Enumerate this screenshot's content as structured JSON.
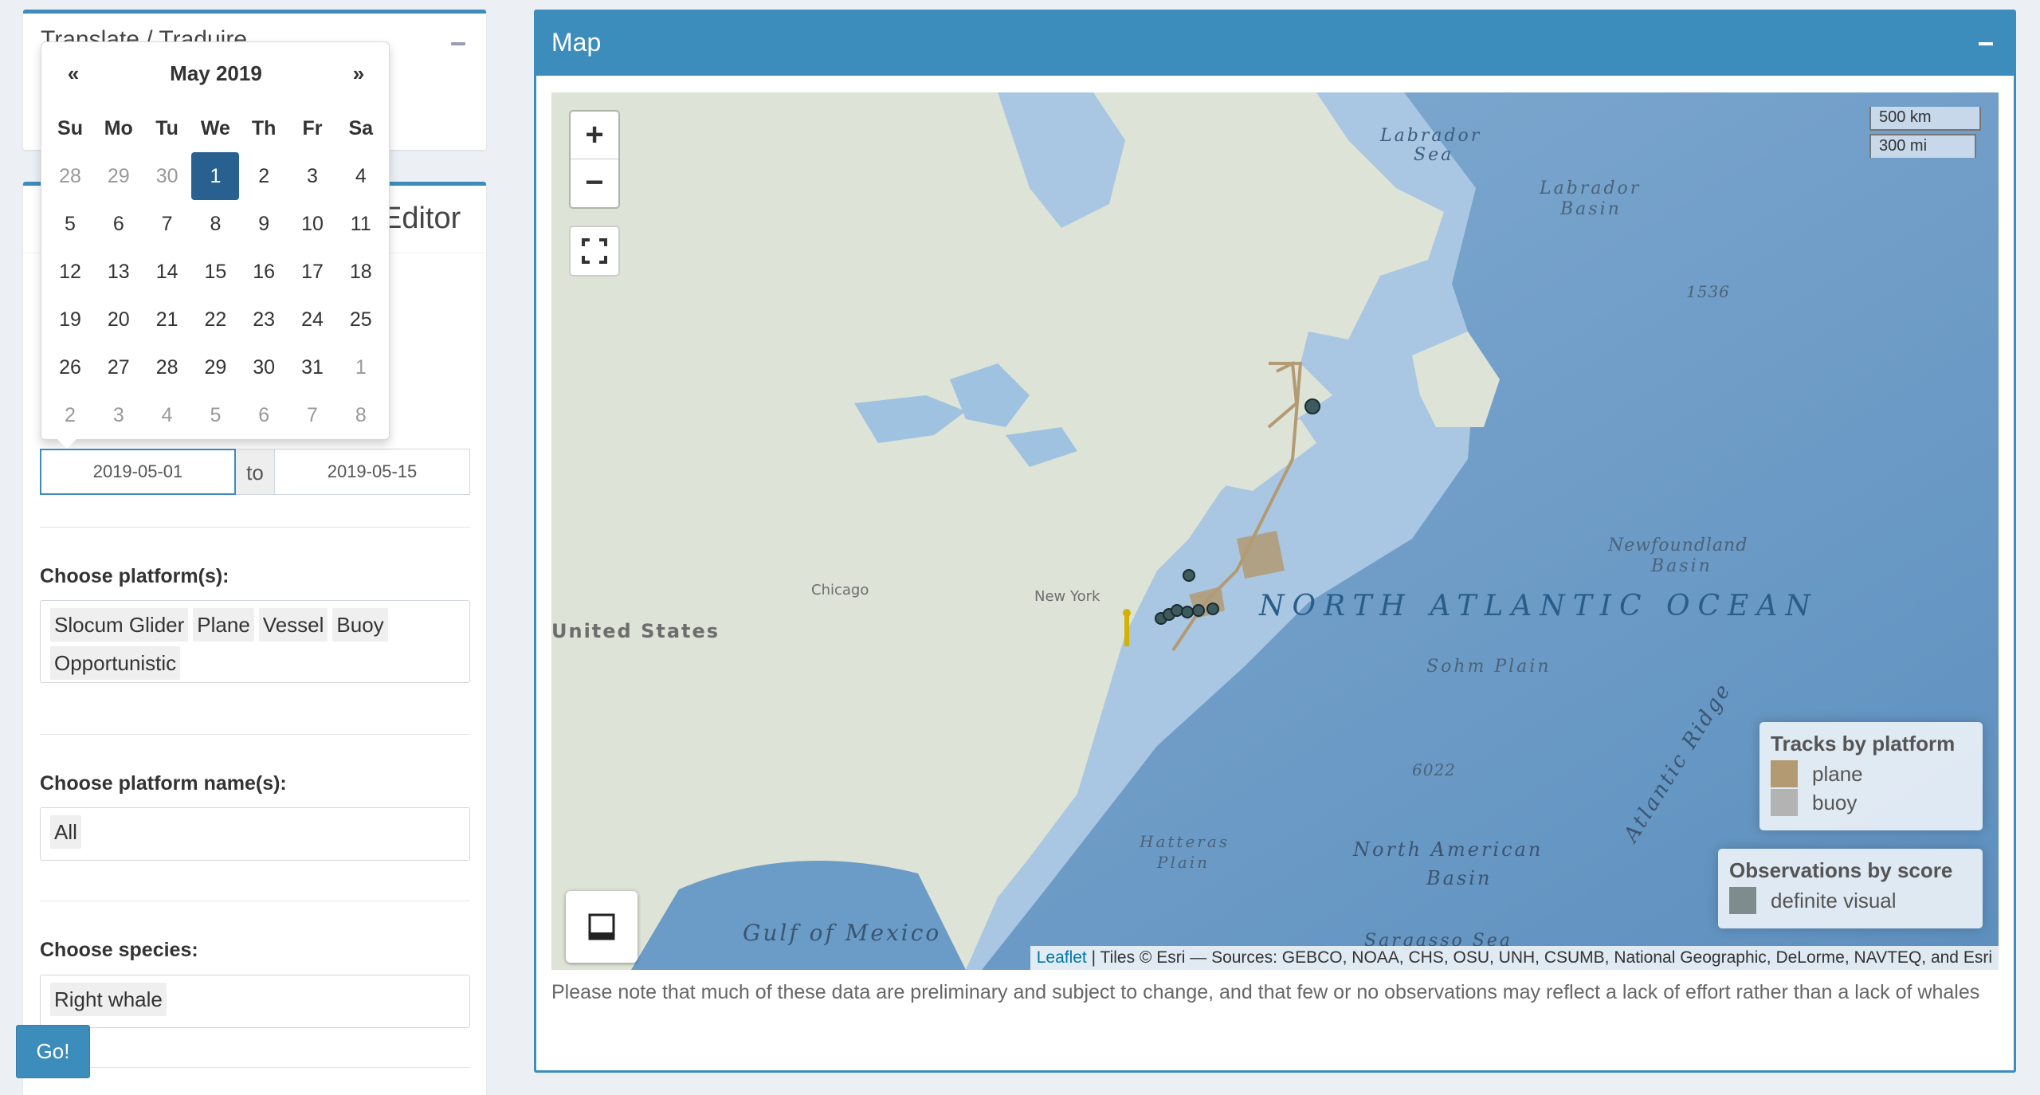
{
  "translate_box": {
    "title": "Translate / Traduire"
  },
  "filters_box": {
    "title_fragment": "Editor"
  },
  "datepicker": {
    "prev": "«",
    "next": "»",
    "month": "May 2019",
    "weekdays": [
      "Su",
      "Mo",
      "Tu",
      "We",
      "Th",
      "Fr",
      "Sa"
    ],
    "weeks": [
      [
        "28",
        "29",
        "30",
        "1",
        "2",
        "3",
        "4"
      ],
      [
        "5",
        "6",
        "7",
        "8",
        "9",
        "10",
        "11"
      ],
      [
        "12",
        "13",
        "14",
        "15",
        "16",
        "17",
        "18"
      ],
      [
        "19",
        "20",
        "21",
        "22",
        "23",
        "24",
        "25"
      ],
      [
        "26",
        "27",
        "28",
        "29",
        "30",
        "31",
        "1"
      ],
      [
        "2",
        "3",
        "4",
        "5",
        "6",
        "7",
        "8"
      ]
    ],
    "selected": "1"
  },
  "date_range": {
    "start": "2019-05-01",
    "separator": "to",
    "end": "2019-05-15"
  },
  "platforms": {
    "label": "Choose platform(s):",
    "chips": [
      "Slocum Glider",
      "Plane",
      "Vessel",
      "Buoy",
      "Opportunistic"
    ]
  },
  "platform_names": {
    "label": "Choose platform name(s):",
    "chips": [
      "All"
    ]
  },
  "species": {
    "label": "Choose species:",
    "chips": [
      "Right whale"
    ]
  },
  "go_button": "Go!",
  "map": {
    "title": "Map",
    "zoom_in": "+",
    "zoom_out": "−",
    "scale_km": "500 km",
    "scale_mi": "300 mi",
    "labels": {
      "labrador_sea_1": "Labrador",
      "labrador_sea_2": "Sea",
      "labrador_basin_1": "Labrador",
      "labrador_basin_2": "Basin",
      "depth_1536": "1536",
      "newfoundland_basin_1": "Newfoundland",
      "newfoundland_basin_2": "Basin",
      "north_atlantic": "NORTH ATLANTIC OCEAN",
      "sohm_plain": "Sohm Plain",
      "depth_6022": "6022",
      "hatteras_1": "Hatteras",
      "hatteras_2": "Plain",
      "na_basin_1": "North American",
      "na_basin_2": "Basin",
      "gulf_mexico": "Gulf of Mexico",
      "united_states": "United States",
      "chicago": "Chicago",
      "new_york": "New York",
      "atlantic_ridge": "Atlantic Ridge",
      "sargasso": "Sargasso Sea"
    },
    "legend_tracks": {
      "title": "Tracks by platform",
      "items": [
        {
          "label": "plane",
          "color": "#b39a73"
        },
        {
          "label": "buoy",
          "color": "#b3b3b3"
        }
      ]
    },
    "legend_obs": {
      "title": "Observations by score",
      "items": [
        {
          "label": "definite visual",
          "color": "#7f8c8d"
        }
      ]
    },
    "attribution": {
      "leaflet": "Leaflet",
      "rest": "| Tiles © Esri — Sources: GEBCO, NOAA, CHS, OSU, UNH, CSUMB, National Geographic, DeLorme, NAVTEQ, and Esri"
    },
    "note": "Please note that much of these data are preliminary and subject to change, and that few or no observations may reflect a lack of effort rather than a lack of whales"
  },
  "colors": {
    "primary": "#3c8dbc",
    "selected_day": "#286090",
    "ocean": "#6a9cc7",
    "land": "#dde3d6",
    "plane_track": "#b39a73",
    "observation": "#3f5a5e"
  }
}
